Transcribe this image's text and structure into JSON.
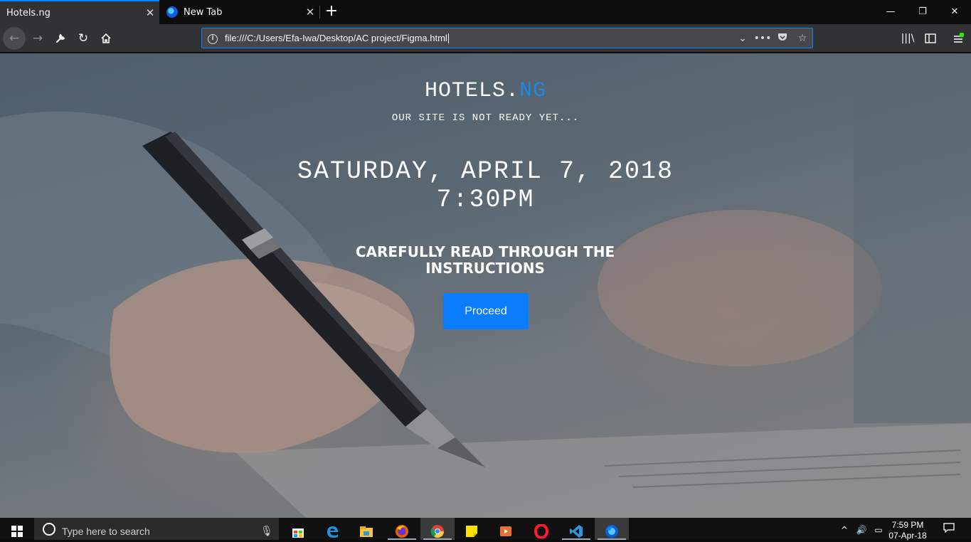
{
  "browser": {
    "tabs": [
      {
        "title": "Hotels.ng",
        "active": true
      },
      {
        "title": "New Tab",
        "active": false
      }
    ],
    "new_tab_label": "+",
    "window_controls": {
      "minimize": "—",
      "restore": "❐",
      "close": "✕"
    },
    "url": "file:///C:/Users/Efa-Iwa/Desktop/AC project/Figma.html",
    "accent_color": "#0a84ff"
  },
  "page": {
    "brand": {
      "prefix": "HOTELS.",
      "suffix": "NG"
    },
    "tagline": "OUR SITE IS NOT READY YET...",
    "date": "SATURDAY, APRIL 7, 2018",
    "time": "7:30PM",
    "instructions": "CAREFULLY READ THROUGH THE INSTRUCTIONS",
    "proceed_label": "Proceed",
    "brand_accent_color": "#1e88e5",
    "button_color": "#0a7cff"
  },
  "taskbar": {
    "search_placeholder": "Type here to search",
    "clock_time": "7:59 PM",
    "clock_date": "07-Apr-18",
    "apps": [
      "task-view",
      "store",
      "edge",
      "file-explorer",
      "firefox",
      "chrome",
      "sticky-notes",
      "media-player",
      "opera",
      "vscode",
      "firefox-active"
    ]
  }
}
